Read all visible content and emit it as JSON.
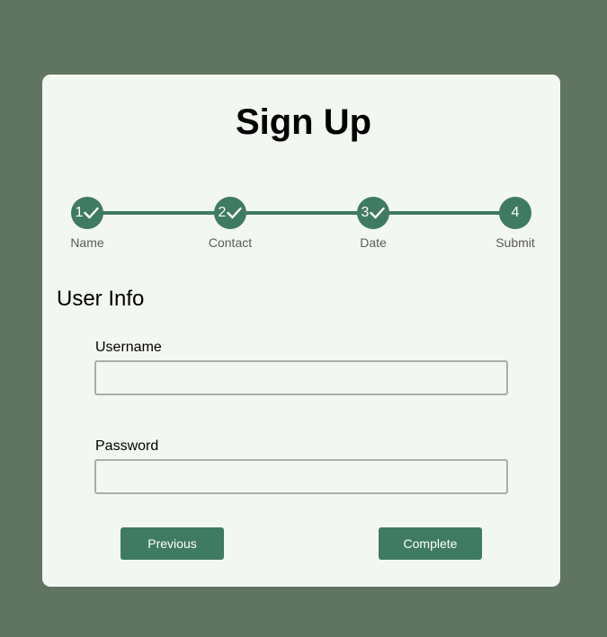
{
  "form": {
    "title": "Sign Up",
    "section_title": "User Info"
  },
  "steps": [
    {
      "number": "1",
      "label": "Name",
      "completed": true
    },
    {
      "number": "2",
      "label": "Contact",
      "completed": true
    },
    {
      "number": "3",
      "label": "Date",
      "completed": true
    },
    {
      "number": "4",
      "label": "Submit",
      "completed": false
    }
  ],
  "fields": {
    "username": {
      "label": "Username",
      "value": "",
      "placeholder": ""
    },
    "password": {
      "label": "Password",
      "value": "",
      "placeholder": ""
    }
  },
  "buttons": {
    "previous": "Previous",
    "complete": "Complete"
  },
  "colors": {
    "background": "#5f7461",
    "card": "#f3f7f1",
    "accent": "#3f7a62"
  },
  "icons": {
    "completed_step": "checkmark-icon"
  }
}
